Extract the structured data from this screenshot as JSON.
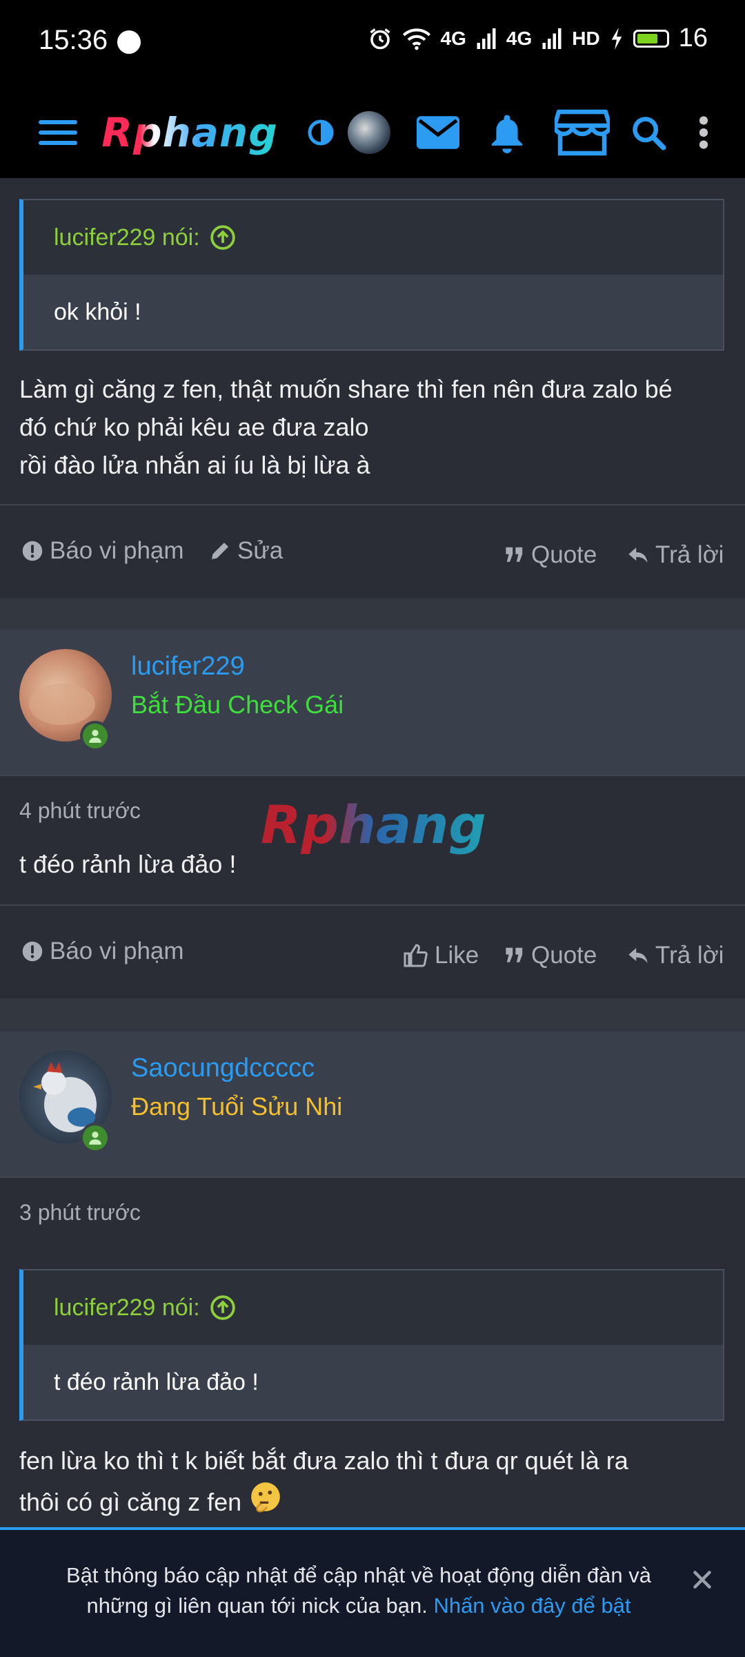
{
  "status": {
    "time": "15:36",
    "net1": "4G",
    "net2": "4G",
    "hd": "HD",
    "battery": "16"
  },
  "header": {
    "logo": "Rphang"
  },
  "post1": {
    "quote_author": "lucifer229 nói:",
    "quote_text": "ok khỏi !",
    "body_lines": [
      "Làm gì căng z fen, thật muốn share thì fen nên đưa zalo bé",
      "đó chứ ko phải kêu ae đưa zalo",
      "rồi đào lửa nhắn ai íu là bị lừa à"
    ],
    "actions": {
      "report": "Báo vi phạm",
      "edit": "Sửa",
      "quote": "Quote",
      "reply": "Trả lời"
    }
  },
  "post2": {
    "username": "lucifer229",
    "user_title": "Bắt Đầu Check Gái",
    "user_title_color": "#3de03a",
    "time": "4 phút trước",
    "body": "t đéo rảnh lừa đảo !",
    "actions": {
      "report": "Báo vi phạm",
      "like": "Like",
      "quote": "Quote",
      "reply": "Trả lời"
    }
  },
  "watermark": "Rphang",
  "post3": {
    "username": "Saocungdccccc",
    "user_title": "Đang Tuổi Sửu Nhi",
    "user_title_color": "#f5c02b",
    "time": "3 phút trước",
    "quote_author": "lucifer229 nói:",
    "quote_text": "t đéo rảnh lừa đảo !",
    "body_lines": [
      "fen lừa ko thì t k biết bắt đưa zalo thì t đưa qr quét là ra",
      "thôi có gì căng z fen"
    ]
  },
  "notice": {
    "text": "Bật thông báo cập nhật để cập nhật về hoạt động diễn đàn và những gì liên quan tới nick của bạn.",
    "link": "Nhấn vào đây để bật"
  },
  "colors": {
    "accent": "#2b9cf2",
    "quote_author": "#8ed03c",
    "online": "#3e8c2d"
  }
}
